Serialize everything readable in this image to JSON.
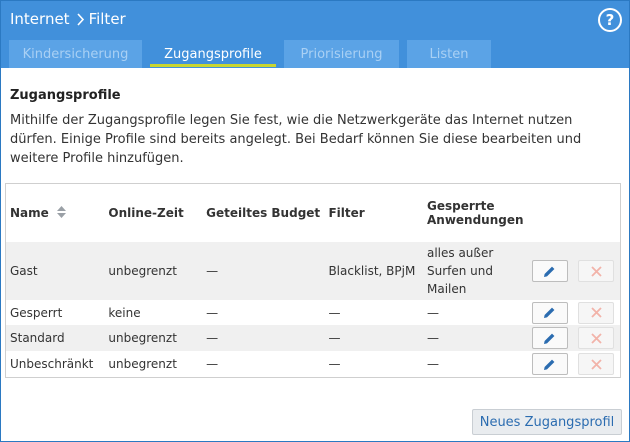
{
  "header": {
    "breadcrumb_parent": "Internet",
    "breadcrumb_current": "Filter",
    "help_label": "?"
  },
  "tabs": [
    {
      "label": "Kindersicherung",
      "active": false
    },
    {
      "label": "Zugangsprofile",
      "active": true
    },
    {
      "label": "Priorisierung",
      "active": false
    },
    {
      "label": "Listen",
      "active": false
    }
  ],
  "section": {
    "title": "Zugangsprofile",
    "description": "Mithilfe der Zugangsprofile legen Sie fest, wie die Netzwerkgeräte das Internet nutzen dürfen. Einige Profile sind bereits angelegt. Bei Bedarf können Sie diese bearbeiten und weitere Profile hinzufügen."
  },
  "table": {
    "columns": {
      "name": "Name",
      "online_time": "Online-Zeit",
      "shared_budget": "Geteiltes Budget",
      "filter": "Filter",
      "blocked_apps_line1": "Gesperrte",
      "blocked_apps_line2": "Anwendungen"
    },
    "rows": [
      {
        "name": "Gast",
        "online_time": "unbegrenzt",
        "shared_budget": "—",
        "filter": "Blacklist, BPjM",
        "apps_line1": "alles außer",
        "apps_line2": "Surfen und",
        "apps_line3": "Mailen"
      },
      {
        "name": "Gesperrt",
        "online_time": "keine",
        "shared_budget": "—",
        "filter": "—",
        "apps": "—"
      },
      {
        "name": "Standard",
        "online_time": "unbegrenzt",
        "shared_budget": "—",
        "filter": "—",
        "apps": "—"
      },
      {
        "name": "Unbeschränkt",
        "online_time": "unbegrenzt",
        "shared_budget": "—",
        "filter": "—",
        "apps": "—"
      }
    ]
  },
  "actions": {
    "new_profile_label": "Neues Zugangsprofil"
  },
  "colors": {
    "header_bg": "#4190db",
    "active_tab_underline": "#c8d531",
    "edit_icon": "#2b6cb0",
    "delete_icon": "#f2b3a9"
  },
  "icons": {
    "edit": "pencil-icon",
    "delete": "close-icon",
    "sort": "sort-arrows-icon",
    "help": "help-icon"
  }
}
